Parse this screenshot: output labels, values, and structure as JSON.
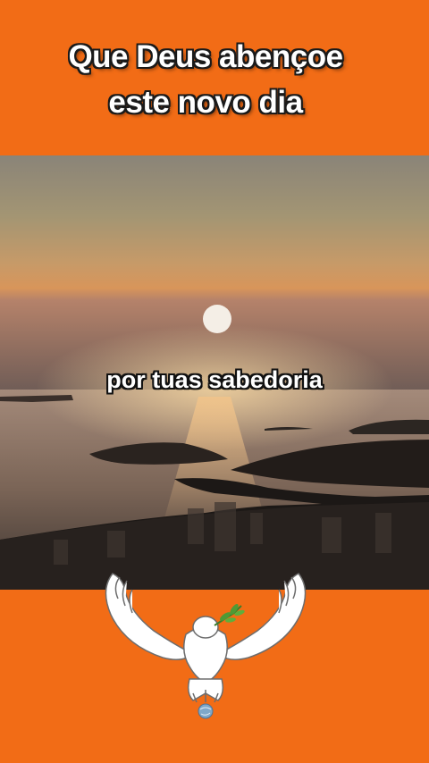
{
  "title": {
    "line1": "Que Deus abençoe",
    "line2": "este novo dia"
  },
  "caption": "por tuas sabedoria",
  "colors": {
    "background": "#f26c16",
    "title_text": "#ffffff",
    "outline": "#1a1a1a"
  },
  "icons": {
    "photo": "sunset-over-bay",
    "emblem": "dove-with-olive-branch-icon"
  }
}
